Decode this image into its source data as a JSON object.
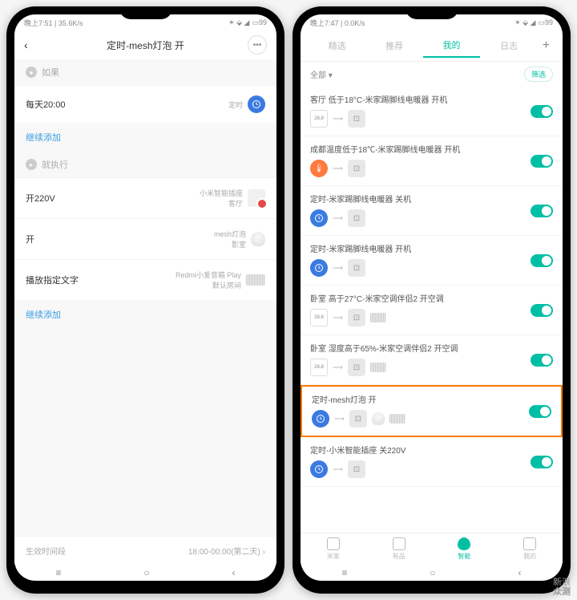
{
  "watermark": {
    "line1": "新浪",
    "line2": "众测"
  },
  "left": {
    "status": {
      "time": "晚上7:51",
      "net": "35.6K/s",
      "battery": "99"
    },
    "header_title": "定时-mesh灯泡 开",
    "if_label": "如果",
    "if_item": {
      "text": "每天20:00",
      "tag": "定时"
    },
    "add_more1": "继续添加",
    "then_label": "就执行",
    "then_items": [
      {
        "label": "开220V",
        "sub1": "小米智能插座",
        "sub2": "客厅"
      },
      {
        "label": "开",
        "sub1": "mesh灯泡",
        "sub2": "影室"
      },
      {
        "label": "播放指定文字",
        "sub1": "Redmi小爱音箱 Play",
        "sub2": "默认房间"
      }
    ],
    "add_more2": "继续添加",
    "footer_left": "生效时间段",
    "footer_right": "18:00-00:00(第二天) ›"
  },
  "right": {
    "status": {
      "time": "晚上7:47",
      "net": "0.0K/s",
      "battery": "99"
    },
    "tabs": [
      "精选",
      "推荐",
      "我的",
      "日志"
    ],
    "active_tab": 2,
    "filter_all": "全部 ▾",
    "filter_btn": "筛选",
    "items": [
      {
        "title": "客厅 低于18°C-米家踢脚线电暖器 开机",
        "icons": [
          "therm",
          "link",
          "gray"
        ]
      },
      {
        "title": "成都温度低于18℃-米家踢脚线电暖器 开机",
        "icons": [
          "orange",
          "link",
          "gray"
        ]
      },
      {
        "title": "定时-米家踢脚线电暖器 关机",
        "icons": [
          "blue",
          "link",
          "gray"
        ]
      },
      {
        "title": "定时-米家踢脚线电暖器 开机",
        "icons": [
          "blue",
          "link",
          "gray"
        ]
      },
      {
        "title": "卧室 高于27°C-米家空调伴侣2 开空调",
        "icons": [
          "therm",
          "link",
          "gray",
          "speaker"
        ]
      },
      {
        "title": "卧室 湿度高于65%-米家空调伴侣2 开空调",
        "icons": [
          "therm",
          "link",
          "gray",
          "speaker"
        ]
      },
      {
        "title": "定时-mesh灯泡 开",
        "icons": [
          "blue",
          "link",
          "gray",
          "bulb",
          "speaker"
        ],
        "highlight": true
      },
      {
        "title": "定时-小米智能插座 关220V",
        "icons": [
          "blue",
          "link",
          "gray"
        ]
      }
    ],
    "bottom_nav": [
      {
        "label": "米家"
      },
      {
        "label": "有品"
      },
      {
        "label": "智能",
        "active": true
      },
      {
        "label": "我的"
      }
    ]
  }
}
